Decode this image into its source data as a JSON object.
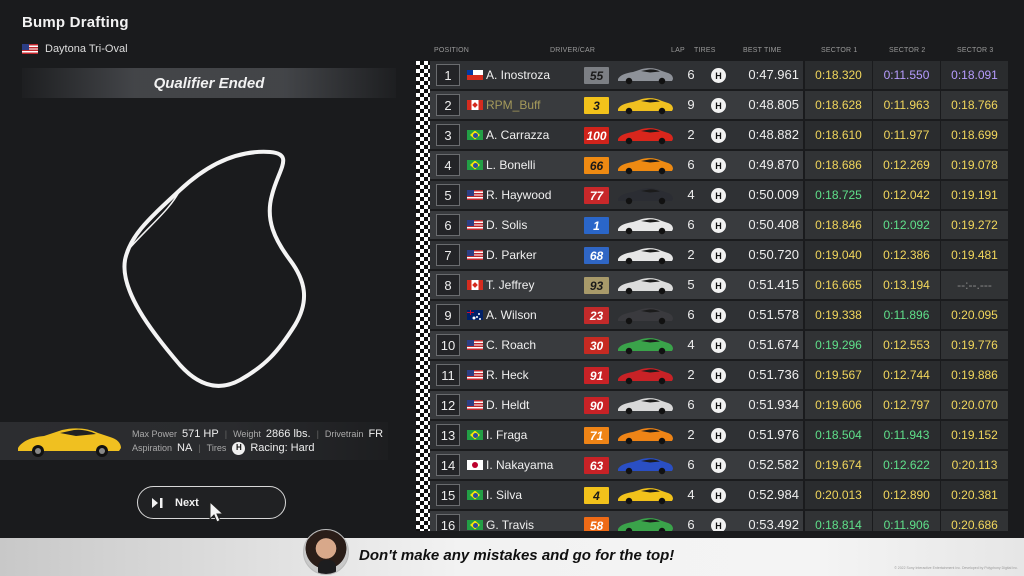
{
  "header": {
    "event_title": "Bump Drafting",
    "track_flag": "us",
    "track_name": "Daytona Tri-Oval"
  },
  "status": "Qualifier Ended",
  "car": {
    "max_power_label": "Max Power",
    "max_power_value": "571 HP",
    "weight_label": "Weight",
    "weight_value": "2866 lbs.",
    "drivetrain_label": "Drivetrain",
    "drivetrain_value": "FR",
    "aspiration_label": "Aspiration",
    "aspiration_value": "NA",
    "tires_label": "Tires",
    "tire_code": "H",
    "tires_value": "Racing: Hard"
  },
  "next_button": {
    "label": "Next",
    "icon": "play-pause-icon"
  },
  "columns": {
    "position": "POSITION",
    "driver_car": "DRIVER/CAR",
    "lap": "LAP",
    "tires": "TIRES",
    "best_time": "BEST TIME",
    "sector1": "SECTOR 1",
    "sector2": "SECTOR 2",
    "sector3": "SECTOR 3"
  },
  "sector_colors": {
    "green": "#5fe08a",
    "yellow": "#f2d75c",
    "purple": "#b69cff",
    "grey": "#8a8a8a"
  },
  "results": [
    {
      "pos": "1",
      "flag": "cl",
      "driver": "A. Inostroza",
      "num": "55",
      "num_bg": "#7c7f84",
      "num_dark": true,
      "car_color": "#8e9299",
      "lap": "6",
      "tire": "H",
      "best": "0:47.961",
      "s1": "0:18.320",
      "s1c": "yellow",
      "s2": "0:11.550",
      "s2c": "purple",
      "s3": "0:18.091",
      "s3c": "purple"
    },
    {
      "pos": "2",
      "flag": "ca",
      "driver": "RPM_Buff",
      "self": true,
      "num": "3",
      "num_bg": "#f2c21b",
      "num_dark": true,
      "car_color": "#f0c020",
      "lap": "9",
      "tire": "H",
      "best": "0:48.805",
      "s1": "0:18.628",
      "s1c": "yellow",
      "s2": "0:11.963",
      "s2c": "yellow",
      "s3": "0:18.766",
      "s3c": "yellow"
    },
    {
      "pos": "3",
      "flag": "br",
      "driver": "A. Carrazza",
      "num": "100",
      "num_bg": "#d0231b",
      "num_dark": false,
      "car_color": "#d9261c",
      "lap": "2",
      "tire": "H",
      "best": "0:48.882",
      "s1": "0:18.610",
      "s1c": "yellow",
      "s2": "0:11.977",
      "s2c": "yellow",
      "s3": "0:18.699",
      "s3c": "yellow"
    },
    {
      "pos": "4",
      "flag": "br",
      "driver": "L. Bonelli",
      "num": "66",
      "num_bg": "#ee8a12",
      "num_dark": true,
      "car_color": "#ee8a12",
      "lap": "6",
      "tire": "H",
      "best": "0:49.870",
      "s1": "0:18.686",
      "s1c": "yellow",
      "s2": "0:12.269",
      "s2c": "yellow",
      "s3": "0:19.078",
      "s3c": "yellow"
    },
    {
      "pos": "5",
      "flag": "us",
      "driver": "R. Haywood",
      "num": "77",
      "num_bg": "#c8282a",
      "num_dark": false,
      "car_color": "#2b2d33",
      "lap": "4",
      "tire": "H",
      "best": "0:50.009",
      "s1": "0:18.725",
      "s1c": "green",
      "s2": "0:12.042",
      "s2c": "yellow",
      "s3": "0:19.191",
      "s3c": "yellow"
    },
    {
      "pos": "6",
      "flag": "us",
      "driver": "D. Solis",
      "num": "1",
      "num_bg": "#2a66c9",
      "num_dark": false,
      "car_color": "#e8e8e8",
      "lap": "6",
      "tire": "H",
      "best": "0:50.408",
      "s1": "0:18.846",
      "s1c": "yellow",
      "s2": "0:12.092",
      "s2c": "green",
      "s3": "0:19.272",
      "s3c": "yellow"
    },
    {
      "pos": "7",
      "flag": "us",
      "driver": "D. Parker",
      "num": "68",
      "num_bg": "#2f66c5",
      "num_dark": false,
      "car_color": "#e6e6e6",
      "lap": "2",
      "tire": "H",
      "best": "0:50.720",
      "s1": "0:19.040",
      "s1c": "yellow",
      "s2": "0:12.386",
      "s2c": "yellow",
      "s3": "0:19.481",
      "s3c": "yellow"
    },
    {
      "pos": "8",
      "flag": "ca",
      "driver": "T. Jeffrey",
      "num": "93",
      "num_bg": "#a89a6a",
      "num_dark": true,
      "car_color": "#dcdcdc",
      "lap": "5",
      "tire": "H",
      "best": "0:51.415",
      "s1": "0:16.665",
      "s1c": "yellow",
      "s2": "0:13.194",
      "s2c": "yellow",
      "s3": "--:--.---",
      "s3c": "grey"
    },
    {
      "pos": "9",
      "flag": "au",
      "driver": "A. Wilson",
      "num": "23",
      "num_bg": "#c22a2a",
      "num_dark": false,
      "car_color": "#3a3a3e",
      "lap": "6",
      "tire": "H",
      "best": "0:51.578",
      "s1": "0:19.338",
      "s1c": "yellow",
      "s2": "0:11.896",
      "s2c": "green",
      "s3": "0:20.095",
      "s3c": "yellow"
    },
    {
      "pos": "10",
      "flag": "us",
      "driver": "C. Roach",
      "num": "30",
      "num_bg": "#c62a22",
      "num_dark": false,
      "car_color": "#3aa34a",
      "lap": "4",
      "tire": "H",
      "best": "0:51.674",
      "s1": "0:19.296",
      "s1c": "green",
      "s2": "0:12.553",
      "s2c": "yellow",
      "s3": "0:19.776",
      "s3c": "yellow"
    },
    {
      "pos": "11",
      "flag": "us",
      "driver": "R. Heck",
      "num": "91",
      "num_bg": "#c82226",
      "num_dark": false,
      "car_color": "#c82226",
      "lap": "2",
      "tire": "H",
      "best": "0:51.736",
      "s1": "0:19.567",
      "s1c": "yellow",
      "s2": "0:12.744",
      "s2c": "yellow",
      "s3": "0:19.886",
      "s3c": "yellow"
    },
    {
      "pos": "12",
      "flag": "us",
      "driver": "D. Heldt",
      "num": "90",
      "num_bg": "#c82226",
      "num_dark": false,
      "car_color": "#d8d8d8",
      "lap": "6",
      "tire": "H",
      "best": "0:51.934",
      "s1": "0:19.606",
      "s1c": "yellow",
      "s2": "0:12.797",
      "s2c": "yellow",
      "s3": "0:20.070",
      "s3c": "yellow"
    },
    {
      "pos": "13",
      "flag": "br",
      "driver": "I. Fraga",
      "num": "71",
      "num_bg": "#ee8416",
      "num_dark": false,
      "car_color": "#ee8416",
      "lap": "2",
      "tire": "H",
      "best": "0:51.976",
      "s1": "0:18.504",
      "s1c": "green",
      "s2": "0:11.943",
      "s2c": "green",
      "s3": "0:19.152",
      "s3c": "yellow"
    },
    {
      "pos": "14",
      "flag": "jp",
      "driver": "I. Nakayama",
      "num": "63",
      "num_bg": "#c82226",
      "num_dark": false,
      "car_color": "#2a4fc4",
      "lap": "6",
      "tire": "H",
      "best": "0:52.582",
      "s1": "0:19.674",
      "s1c": "yellow",
      "s2": "0:12.622",
      "s2c": "green",
      "s3": "0:20.113",
      "s3c": "yellow"
    },
    {
      "pos": "15",
      "flag": "br",
      "driver": "I. Silva",
      "num": "4",
      "num_bg": "#f2c21b",
      "num_dark": true,
      "car_color": "#f2c21b",
      "lap": "4",
      "tire": "H",
      "best": "0:52.984",
      "s1": "0:20.013",
      "s1c": "yellow",
      "s2": "0:12.890",
      "s2c": "yellow",
      "s3": "0:20.381",
      "s3c": "yellow"
    },
    {
      "pos": "16",
      "flag": "br",
      "driver": "G. Travis",
      "num": "58",
      "num_bg": "#ee6a16",
      "num_dark": false,
      "car_color": "#3aa34a",
      "lap": "6",
      "tire": "H",
      "best": "0:53.492",
      "s1": "0:18.814",
      "s1c": "green",
      "s2": "0:11.906",
      "s2c": "green",
      "s3": "0:20.686",
      "s3c": "yellow"
    }
  ],
  "message": "Don't make any mistakes and go for the top!",
  "copyright": "© 2022 Sony Interactive Entertainment Inc. Developed by Polyphony Digital Inc."
}
